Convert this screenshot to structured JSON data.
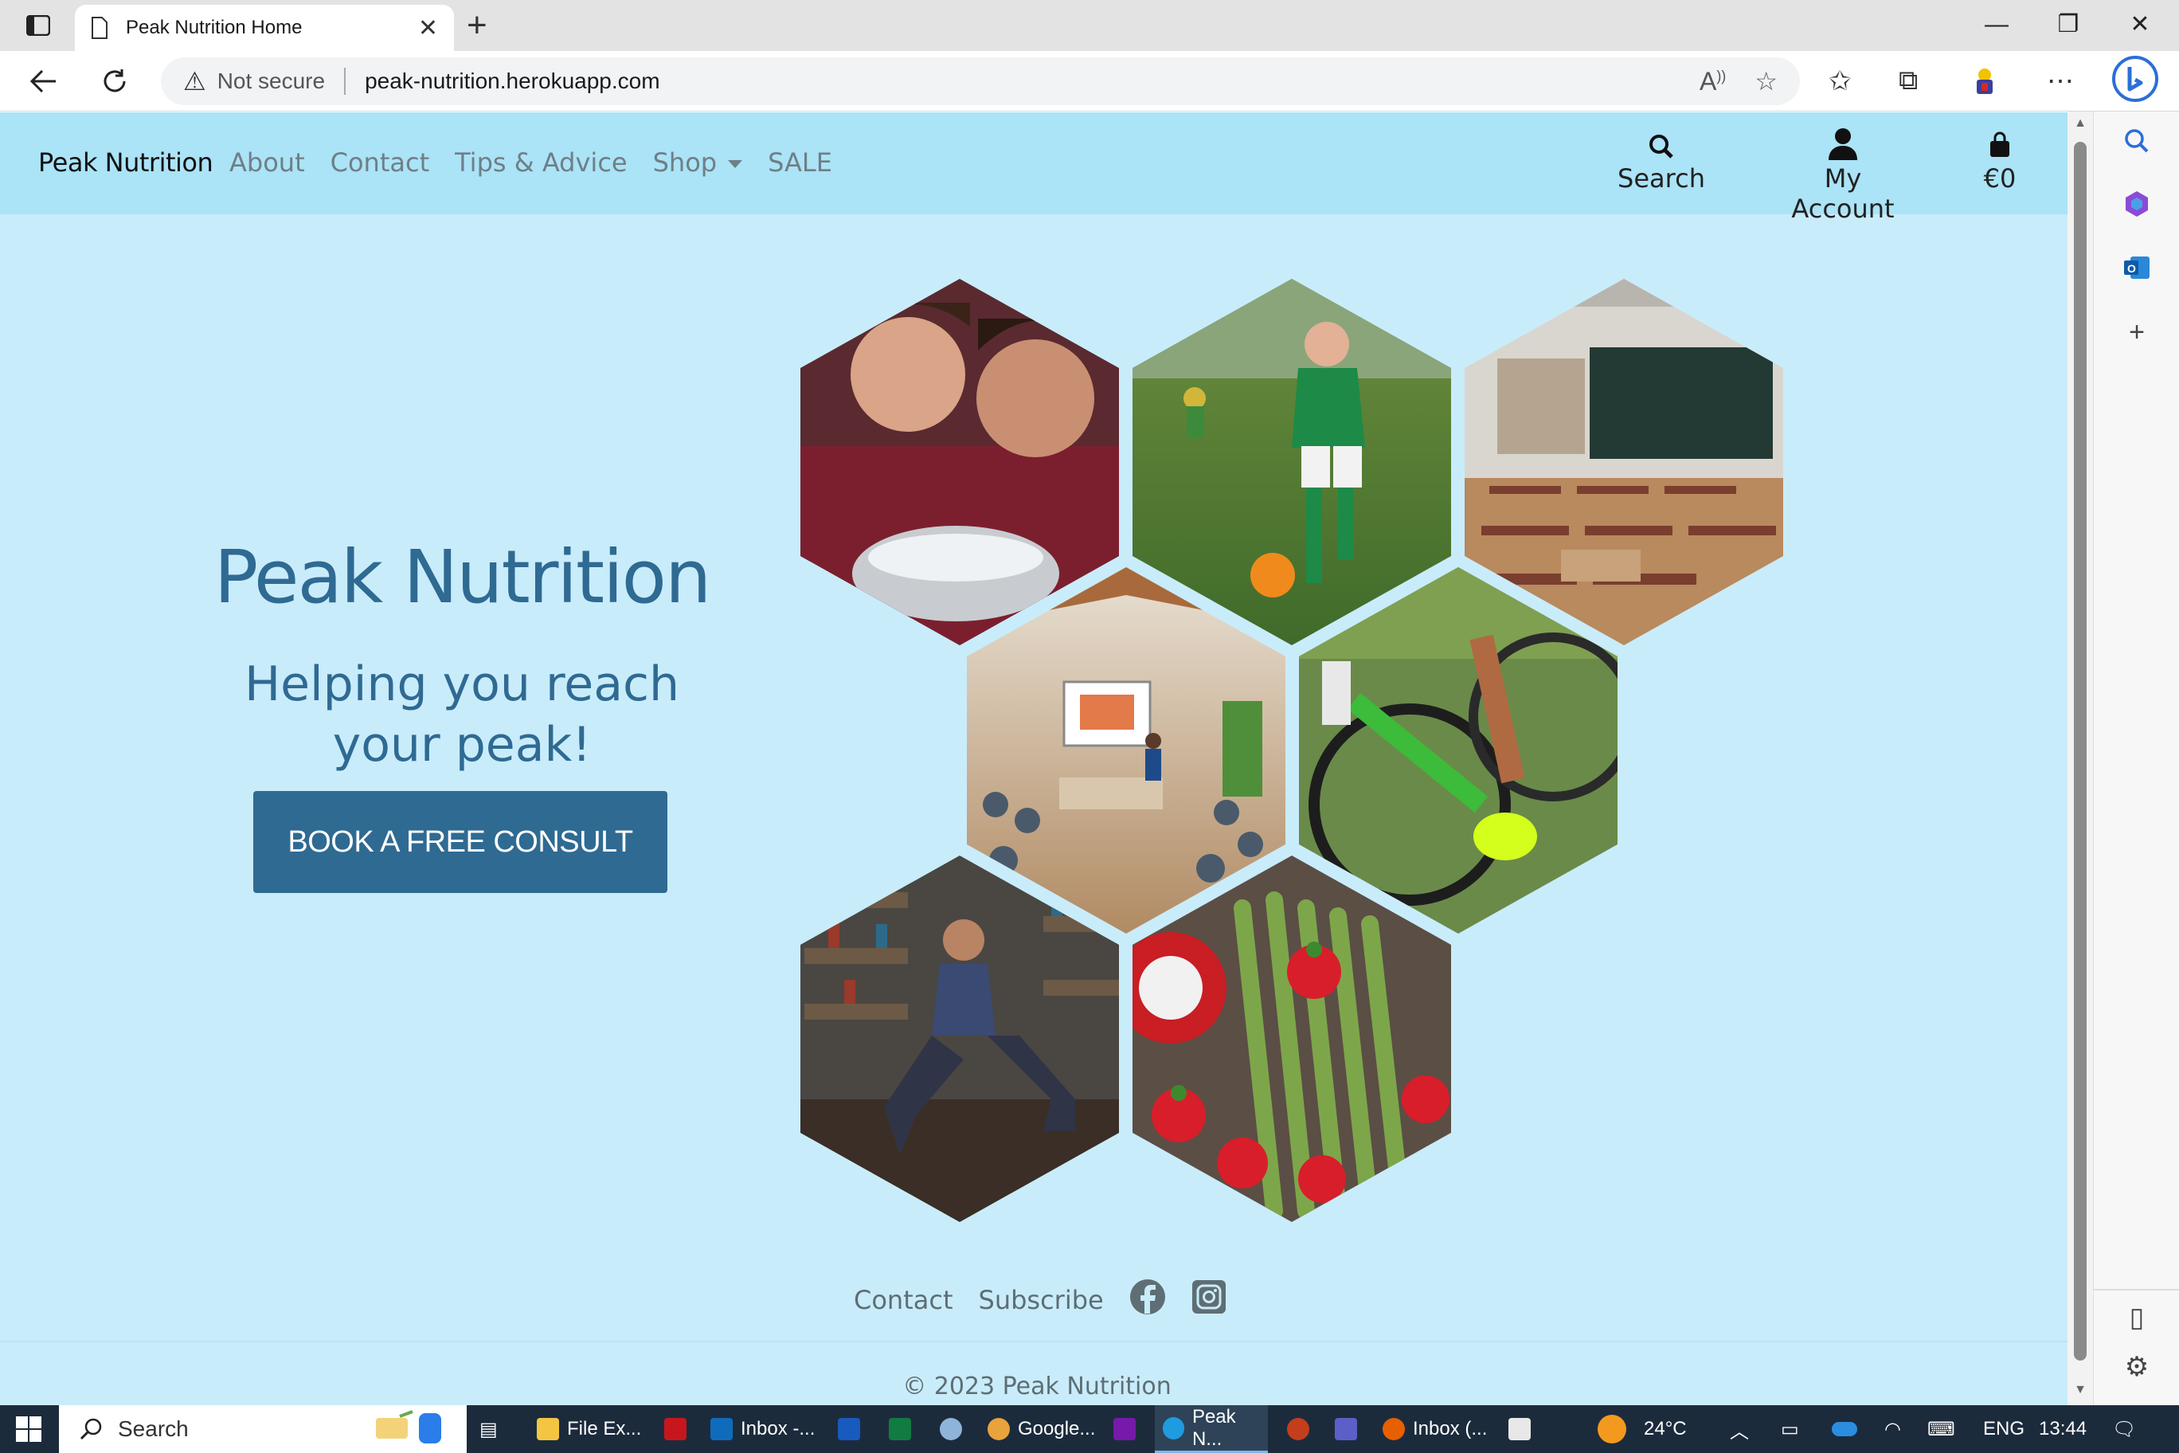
{
  "browser": {
    "tab_title": "Peak Nutrition Home",
    "new_tab_label": "+",
    "address": {
      "security_label": "Not secure",
      "url": "peak-nutrition.herokuapp.com"
    }
  },
  "site": {
    "brand": "Peak Nutrition",
    "nav_links": [
      "About",
      "Contact",
      "Tips & Advice",
      "Shop",
      "SALE"
    ],
    "nav_right": {
      "search_label": "Search",
      "account_label": "My Account",
      "cart_total": "€0"
    },
    "hero": {
      "title": "Peak Nutrition",
      "subtitle_line1": "Helping you reach",
      "subtitle_line2": "your peak!",
      "cta_label": "BOOK A FREE CONSULT"
    },
    "footer": {
      "contact_label": "Contact",
      "subscribe_label": "Subscribe",
      "copyright": "© 2023 Peak Nutrition"
    },
    "colors": {
      "page_bg": "#c9ecfb",
      "nav_bg": "#abe3f7",
      "accent": "#2f6a92"
    }
  },
  "taskbar": {
    "search_label": "Search",
    "apps": [
      "File Ex...",
      "Inbox -...",
      "Google...",
      "Peak N...",
      "Inbox (..."
    ],
    "weather": "24°C",
    "language": "ENG",
    "time": "13:44"
  }
}
